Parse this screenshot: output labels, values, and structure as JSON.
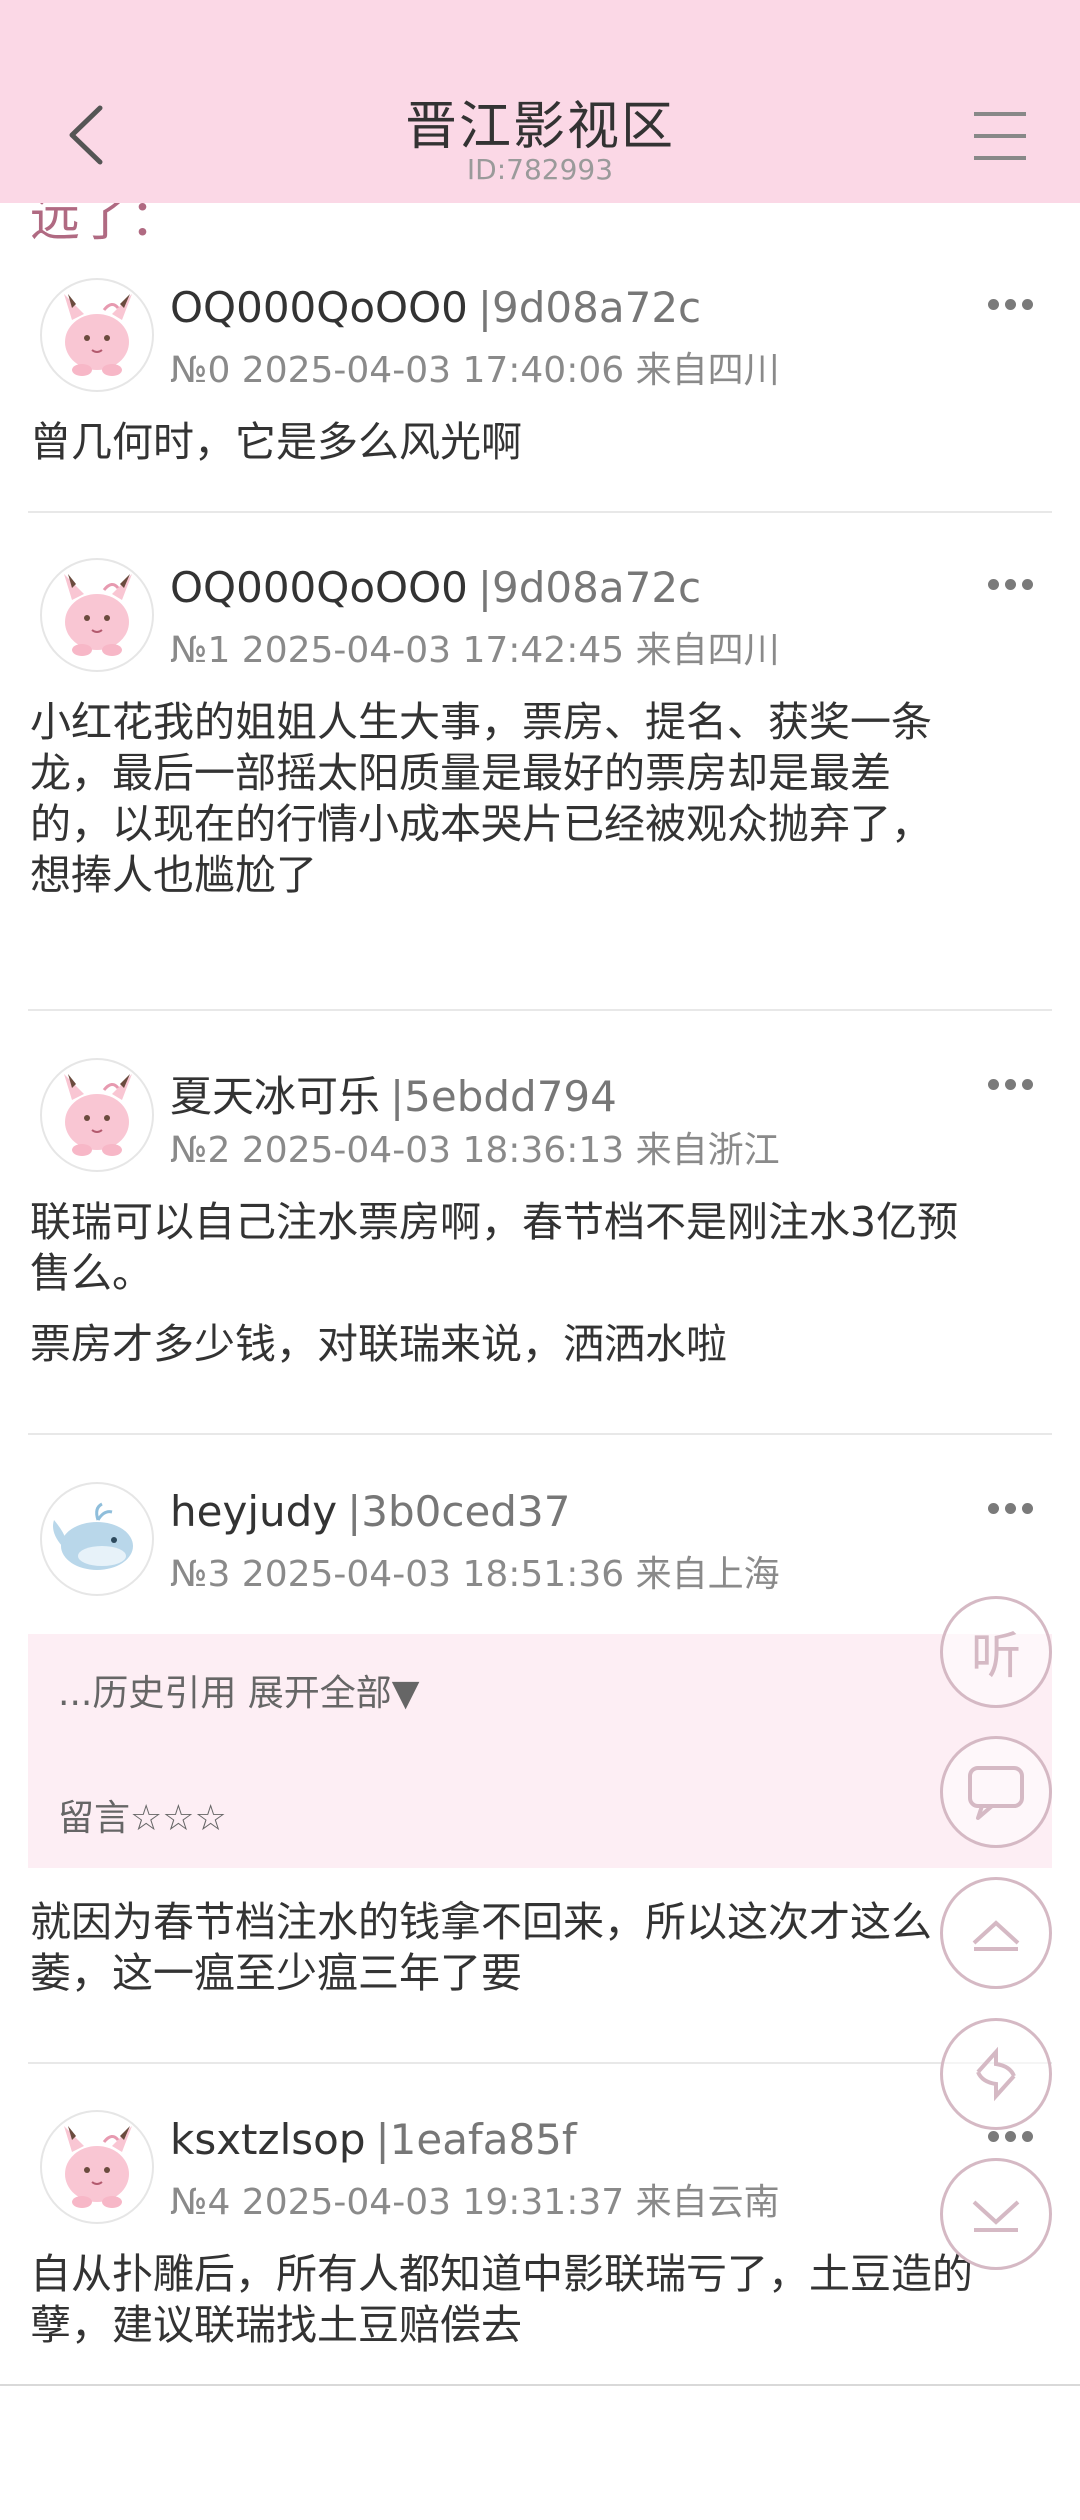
{
  "header": {
    "title": "晋江影视区",
    "subtitle": "ID:782993"
  },
  "peek_text": "远了：",
  "posts": [
    {
      "name": "OQ000QoOO0",
      "uid": "|9d08a72c",
      "meta": "№0 2025-04-03 17:40:06 来自四川",
      "lines": [
        "曾几何时，它是多么风光啊"
      ]
    },
    {
      "name": "OQ000QoOO0",
      "uid": "|9d08a72c",
      "meta": "№1 2025-04-03 17:42:45 来自四川",
      "lines": [
        "小红花我的姐姐人生大事，票房、提名、获奖一条",
        "龙，最后一部摇太阳质量是最好的票房却是最差",
        "的，以现在的行情小成本哭片已经被观众抛弃了，",
        "想捧人也尴尬了"
      ]
    },
    {
      "name": "夏天冰可乐",
      "uid": "|5ebdd794",
      "meta": "№2 2025-04-03 18:36:13 来自浙江",
      "lines": [
        "联瑞可以自己注水票房啊，春节档不是刚注水3亿预",
        "售么。",
        "票房才多少钱，对联瑞来说，洒洒水啦"
      ]
    },
    {
      "name": "heyjudy",
      "uid": "|3b0ced37",
      "meta": "№3 2025-04-03 18:51:36 来自上海",
      "quote_head": "...历史引用 展开全部▼",
      "quote_body": "留言☆☆☆",
      "lines": [
        "就因为春节档注水的钱拿不回来，所以这次才这么",
        "萎，这一瘟至少瘟三年了要"
      ]
    },
    {
      "name": "ksxtzlsop",
      "uid": "|1eafa85f",
      "meta": "№4 2025-04-03 19:31:37 来自云南",
      "lines": [
        "自从扑雕后，所有人都知道中影联瑞亏了，土豆造的",
        "孽，建议联瑞找土豆赔偿去"
      ]
    }
  ],
  "fab": {
    "listen_label": "听"
  },
  "colors": {
    "header_bg": "#fbd8e6",
    "quote_bg": "#fdeef4",
    "fab_border": "#d5b9c4"
  },
  "icons": [
    "back-arrow-icon",
    "hamburger-menu-icon",
    "more-dots-icon",
    "comment-icon",
    "scroll-top-icon",
    "refresh-icon",
    "scroll-bottom-icon",
    "clefairy-avatar",
    "whale-avatar"
  ]
}
